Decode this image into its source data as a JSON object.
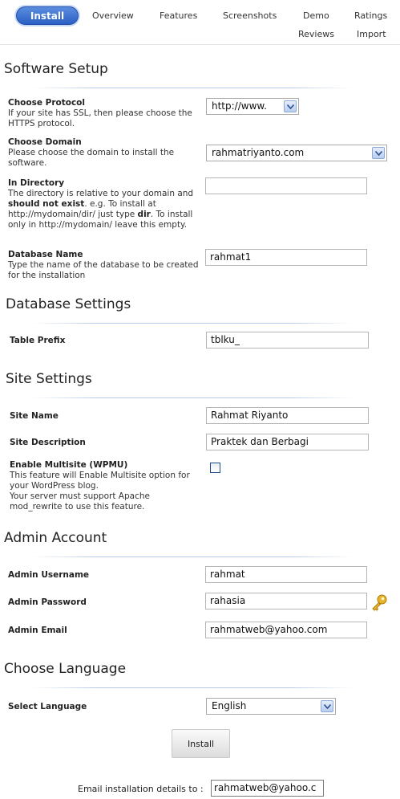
{
  "tabs": {
    "install": "Install",
    "overview": "Overview",
    "features": "Features",
    "screenshots": "Screenshots",
    "demo": "Demo",
    "ratings": "Ratings",
    "reviews": "Reviews",
    "import": "Import"
  },
  "software_setup": {
    "title": "Software Setup",
    "protocol": {
      "label": "Choose Protocol",
      "desc": "If your site has SSL, then please choose the HTTPS protocol.",
      "value": "http://www."
    },
    "domain": {
      "label": "Choose Domain",
      "desc": "Please choose the domain to install the software.",
      "value": "rahmatriyanto.com"
    },
    "directory": {
      "label": "In Directory",
      "desc_1": "The directory is relative to your domain and ",
      "desc_bold_1": "should not exist",
      "desc_2": ". e.g. To install at http://mydomain/dir/ just type ",
      "desc_bold_2": "dir",
      "desc_3": ". To install only in http://mydomain/ leave this empty.",
      "value": ""
    },
    "database_name": {
      "label": "Database Name",
      "desc": "Type the name of the database to be created for the installation",
      "value": "rahmat1"
    }
  },
  "database_settings": {
    "title": "Database Settings",
    "table_prefix": {
      "label": "Table Prefix",
      "value": "tblku_"
    }
  },
  "site_settings": {
    "title": "Site Settings",
    "site_name": {
      "label": "Site Name",
      "value": "Rahmat Riyanto"
    },
    "site_description": {
      "label": "Site Description",
      "value": "Praktek dan Berbagi"
    },
    "multisite": {
      "label": "Enable Multisite (WPMU)",
      "desc_1": "This feature will Enable Multisite option for your WordPress blog.",
      "desc_2": "Your server must support Apache mod_rewrite to use this feature.",
      "checked": false
    }
  },
  "admin_account": {
    "title": "Admin Account",
    "username": {
      "label": "Admin Username",
      "value": "rahmat"
    },
    "password": {
      "label": "Admin Password",
      "value": "rahasia"
    },
    "email": {
      "label": "Admin Email",
      "value": "rahmatweb@yahoo.com"
    }
  },
  "language": {
    "title": "Choose Language",
    "select": {
      "label": "Select Language",
      "value": "English"
    }
  },
  "install_button": "Install",
  "email_details": {
    "label": "Email installation details to :",
    "value": "rahmatweb@yahoo.c"
  },
  "colors": {
    "install_tab": "#2b5fc4",
    "key_icon": "#d9a21b"
  },
  "icons": {
    "dropdown": "chevron-down-icon",
    "password_generator": "key-icon"
  }
}
